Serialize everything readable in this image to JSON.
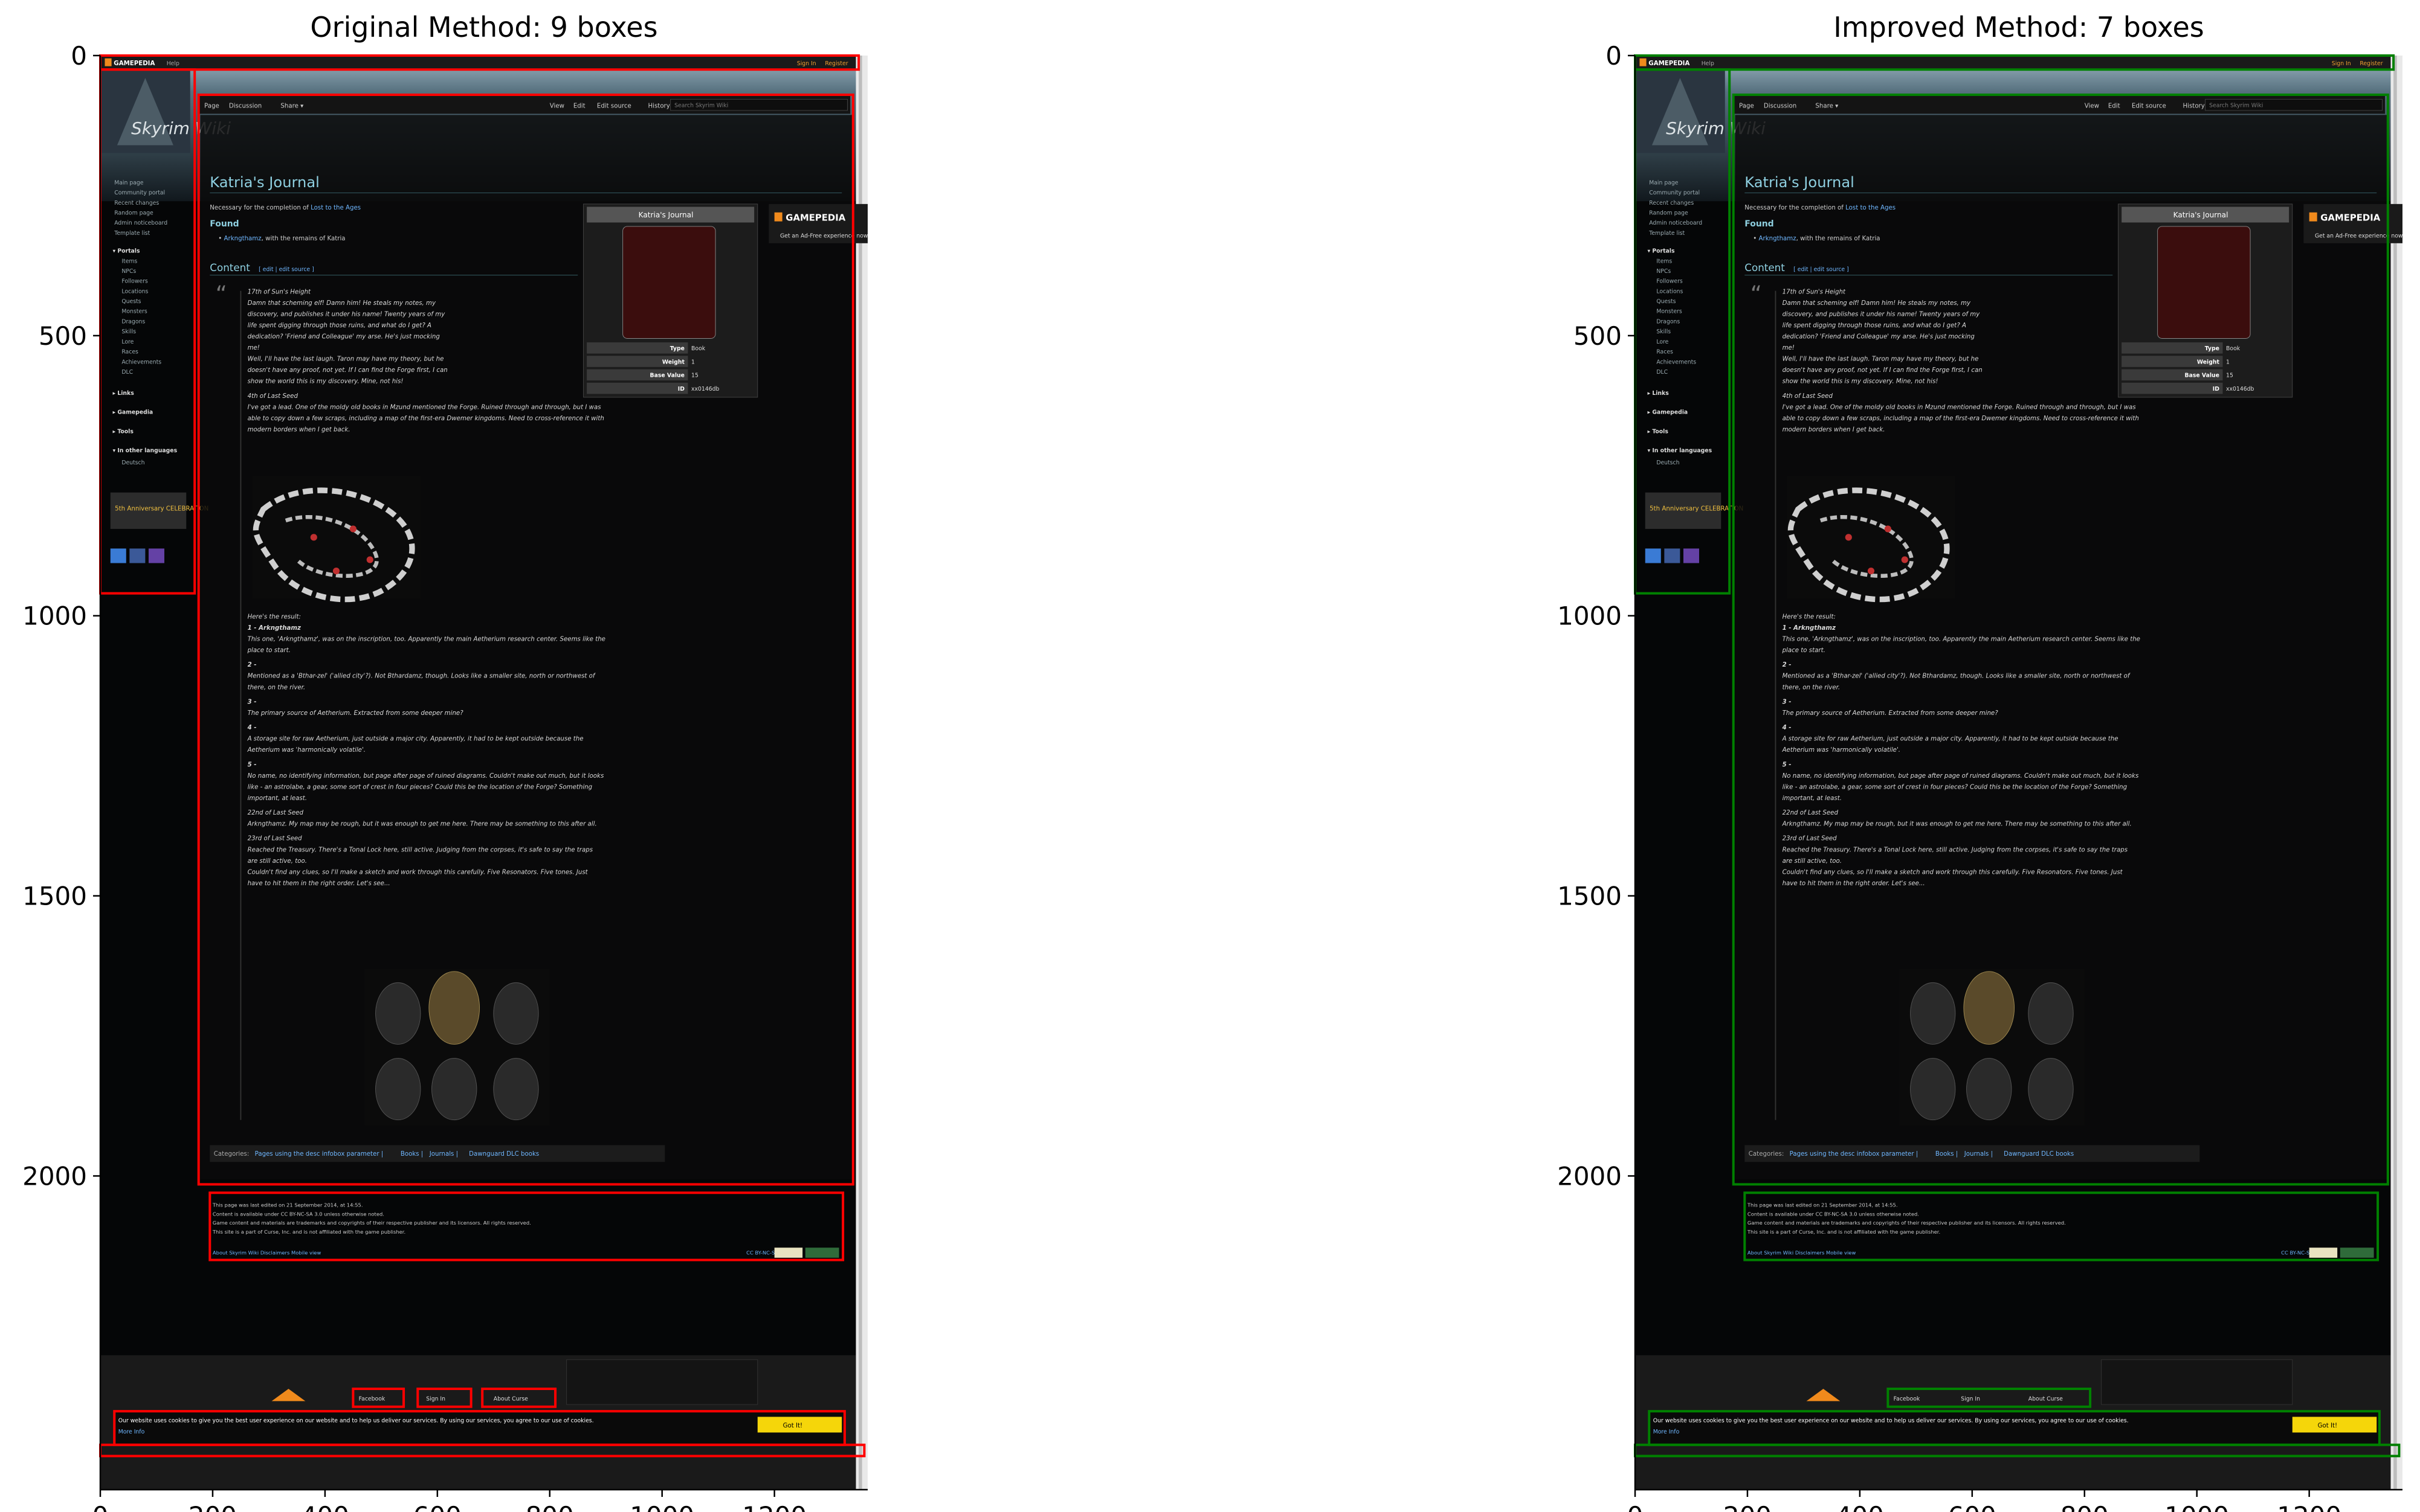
{
  "chart_data": [
    {
      "type": "image",
      "title": "Original Method: 9 boxes",
      "xticks": [
        "0",
        "200",
        "400",
        "600",
        "800",
        "1000",
        "1200"
      ],
      "yticks": [
        "0",
        "500",
        "1000",
        "1500",
        "2000"
      ],
      "xlim": [
        0,
        1366
      ],
      "ylim": [
        2560,
        0
      ],
      "box_color": "#ff0000",
      "boxes": [
        {
          "x0": 0,
          "y0": 0,
          "x1": 1350,
          "y1": 25
        },
        {
          "x0": 0,
          "y0": 25,
          "x1": 168,
          "y1": 960
        },
        {
          "x0": 175,
          "y0": 70,
          "x1": 1340,
          "y1": 2015
        },
        {
          "x0": 195,
          "y0": 2030,
          "x1": 1322,
          "y1": 2150
        },
        {
          "x0": 450,
          "y0": 2380,
          "x1": 540,
          "y1": 2412
        },
        {
          "x0": 565,
          "y0": 2380,
          "x1": 660,
          "y1": 2412
        },
        {
          "x0": 680,
          "y0": 2380,
          "x1": 810,
          "y1": 2412
        },
        {
          "x0": 25,
          "y0": 2420,
          "x1": 1325,
          "y1": 2480
        },
        {
          "x0": 0,
          "y0": 2480,
          "x1": 1360,
          "y1": 2500
        }
      ]
    },
    {
      "type": "image",
      "title": "Improved Method: 7 boxes",
      "xticks": [
        "0",
        "200",
        "400",
        "600",
        "800",
        "1000",
        "1200"
      ],
      "yticks": [
        "0",
        "500",
        "1000",
        "1500",
        "2000"
      ],
      "xlim": [
        0,
        1366
      ],
      "ylim": [
        2560,
        0
      ],
      "box_color": "#008000",
      "boxes": [
        {
          "x0": 0,
          "y0": 0,
          "x1": 1350,
          "y1": 25
        },
        {
          "x0": 0,
          "y0": 25,
          "x1": 168,
          "y1": 960
        },
        {
          "x0": 175,
          "y0": 70,
          "x1": 1340,
          "y1": 2015
        },
        {
          "x0": 195,
          "y0": 2030,
          "x1": 1322,
          "y1": 2150
        },
        {
          "x0": 450,
          "y0": 2380,
          "x1": 810,
          "y1": 2412
        },
        {
          "x0": 25,
          "y0": 2420,
          "x1": 1325,
          "y1": 2480
        },
        {
          "x0": 0,
          "y0": 2480,
          "x1": 1360,
          "y1": 2500
        }
      ]
    }
  ],
  "screenshot_text": {
    "brand": "GAMEPEDIA",
    "help": "Help",
    "sign_in": "Sign In",
    "register": "Register",
    "wiki_logo": "Skyrim Wiki",
    "tabs": [
      "Page",
      "Discussion",
      "Share ▾"
    ],
    "actions": [
      "View",
      "Edit",
      "Edit source",
      "History"
    ],
    "search_placeholder": "Search Skyrim Wiki",
    "article_title": "Katria's Journal",
    "intro_prefix": "Necessary for the completion of ",
    "intro_link": "Lost to the Ages",
    "found_heading": "Found",
    "found_item": "Arkngthamz",
    "found_suffix": ", with the remains of Katria",
    "content_heading": "Content",
    "content_edit": "[ edit | edit source ]",
    "infobox_title": "Katria's Journal",
    "infobox_rows": [
      {
        "k": "Type",
        "v": "Book"
      },
      {
        "k": "Weight",
        "v": "1"
      },
      {
        "k": "Base Value",
        "v": "15"
      },
      {
        "k": "ID",
        "v": "xx0146db"
      }
    ],
    "ad_text": "Get an Ad-Free experience now!",
    "quote_lines": [
      "17th of Sun's Height",
      "Damn that scheming elf! Damn him! He steals my notes, my",
      "discovery, and publishes it under his name! Twenty years of my",
      "life spent digging through those ruins, and what do I get? A",
      "dedication? 'Friend and Colleague' my arse. He's just mocking",
      "me!",
      "Well, I'll have the last laugh. Taron may have my theory, but he",
      "doesn't have any proof, not yet. If I can find the Forge first, I can",
      "show the world this is my discovery. Mine, not his!",
      "4th of Last Seed",
      "I've got a lead. One of the moldy old books in Mzund mentioned the Forge. Ruined through and through, but I was",
      "able to copy down a few scraps, including a map of the first-era Dwemer kingdoms. Need to cross-reference it with",
      "modern borders when I get back.",
      "Here's the result:",
      "1 - Arkngthamz",
      "This one, 'Arkngthamz', was on the inscription, too. Apparently the main Aetherium research center. Seems like the",
      "place to start.",
      "2 -",
      "Mentioned as a 'Bthar-zel' ('allied city'?). Not Bthardamz, though. Looks like a smaller site, north or northwest of",
      "there, on the river.",
      "3 -",
      "The primary source of Aetherium. Extracted from some deeper mine?",
      "4 -",
      "A storage site for raw Aetherium, just outside a major city. Apparently, it had to be kept outside because the",
      "Aetherium was 'harmonically volatile'.",
      "5 -",
      "No name, no identifying information, but page after page of ruined diagrams. Couldn't make out much, but it looks",
      "like - an astrolabe, a gear, some sort of crest in four pieces? Could this be the location of the Forge? Something",
      "important, at least.",
      "22nd of Last Seed",
      "Arkngthamz. My map may be rough, but it was enough to get me here. There may be something to this after all.",
      "23rd of Last Seed",
      "Reached the Treasury. There's a Tonal Lock here, still active. Judging from the corpses, it's safe to say the traps",
      "are still active, too.",
      "Couldn't find any clues, so I'll make a sketch and work through this carefully. Five Resonators. Five tones. Just",
      "have to hit them in the right order. Let's see..."
    ],
    "categories_label": "Categories:",
    "categories": [
      "Pages using the desc infobox parameter",
      "Books",
      "Journals",
      "Dawnguard DLC books"
    ],
    "sidebar_links": [
      "Main page",
      "Community portal",
      "Recent changes",
      "Random page",
      "Admin noticeboard",
      "Template list"
    ],
    "sidebar_portals_head": "▾ Portals",
    "sidebar_portals": [
      "Items",
      "NPCs",
      "Followers",
      "Locations",
      "Quests",
      "Monsters",
      "Dragons",
      "Skills",
      "Lore",
      "Races",
      "Achievements",
      "DLC"
    ],
    "sidebar_sections": [
      "▸ Links",
      "▸ Gamepedia",
      "▸ Tools",
      "▾ In other languages"
    ],
    "sidebar_lang": "Deutsch",
    "anniv_badge": "5th Anniversary CELEBRATION",
    "footer_lines": [
      "This page was last edited on 21 September 2014, at 14:55.",
      "Content is available under CC BY-NC-SA 3.0 unless otherwise noted.",
      "Game content and materials are trademarks and copyrights of their respective publisher and its licensors. All rights reserved.",
      "This site is a part of Curse, Inc. and is not affiliated with the game publisher."
    ],
    "footer_links": "About Skyrim Wiki   Disclaimers   Mobile view",
    "footer_license": "CC BY-NC-SA 3.0",
    "bottom_links": [
      "Facebook",
      "Sign In",
      "About Curse"
    ],
    "cookie_text": "Our website uses cookies to give you the best user experience on our website and to help us deliver our services. By using our services, you agree to our use of cookies.",
    "cookie_more": "More Info",
    "cookie_btn": "Got It!"
  }
}
